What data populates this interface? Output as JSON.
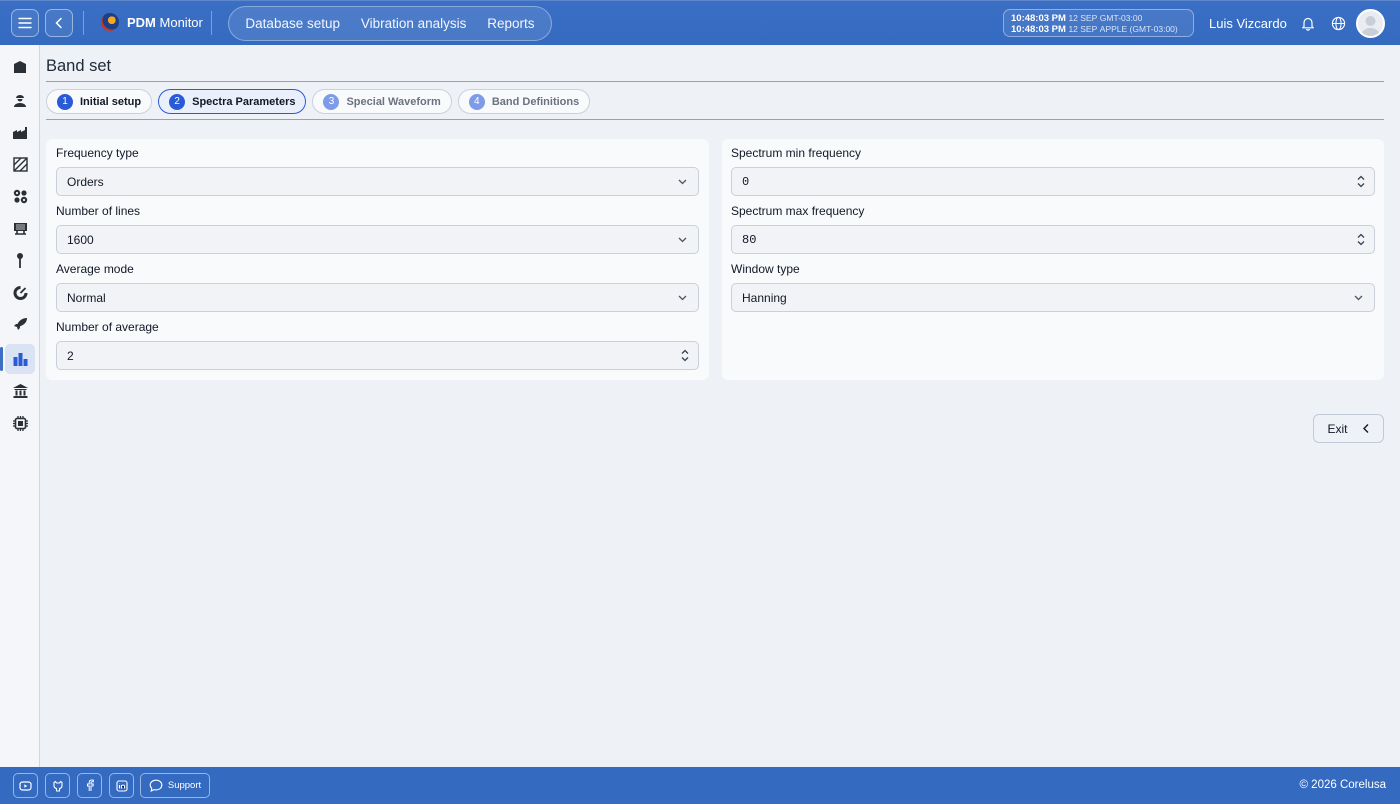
{
  "header": {
    "app_name_bold": "PDM",
    "app_name_rest": "Monitor",
    "nav": [
      "Database setup",
      "Vibration analysis",
      "Reports"
    ],
    "clock": [
      {
        "time": "10:48:03 PM",
        "date": "12 SEP",
        "zone": "GMT-03:00"
      },
      {
        "time": "10:48:03 PM",
        "date": "12 SEP",
        "zone": "APPLE (GMT-03:00)"
      }
    ],
    "user_name": "Luis Vizcardo"
  },
  "sidebar": {
    "items": [
      "building-icon",
      "worker-icon",
      "factory-icon",
      "hatched-square-icon",
      "gears-icon",
      "machine-icon",
      "pin-icon",
      "speedometer-icon",
      "rocket-icon",
      "bar-chart-icon",
      "institution-icon",
      "chip-icon"
    ],
    "active_index": 9
  },
  "page": {
    "title": "Band set",
    "steps": [
      {
        "num": "1",
        "label": "Initial setup",
        "state": "done"
      },
      {
        "num": "2",
        "label": "Spectra Parameters",
        "state": "current"
      },
      {
        "num": "3",
        "label": "Special Waveform",
        "state": "pending"
      },
      {
        "num": "4",
        "label": "Band Definitions",
        "state": "pending"
      }
    ]
  },
  "form_left": {
    "frequency_type": {
      "label": "Frequency type",
      "value": "Orders"
    },
    "number_of_lines": {
      "label": "Number of lines",
      "value": "1600"
    },
    "average_mode": {
      "label": "Average mode",
      "value": "Normal"
    },
    "number_of_average": {
      "label": "Number of average",
      "value": "2"
    }
  },
  "form_right": {
    "spectrum_min_frequency": {
      "label": "Spectrum min frequency",
      "value": "0"
    },
    "spectrum_max_frequency": {
      "label": "Spectrum max frequency",
      "value": "80"
    },
    "window_type": {
      "label": "Window type",
      "value": "Hanning"
    }
  },
  "actions": {
    "exit_label": "Exit"
  },
  "footer": {
    "icons": [
      "youtube-icon",
      "github-icon",
      "facebook-icon",
      "linkedin-icon"
    ],
    "support_label": "Support",
    "copyright": "© 2026 Corelusa"
  },
  "colors": {
    "primary": "#346ac0",
    "accent": "#2a5bd7",
    "background": "#eef1f6"
  }
}
